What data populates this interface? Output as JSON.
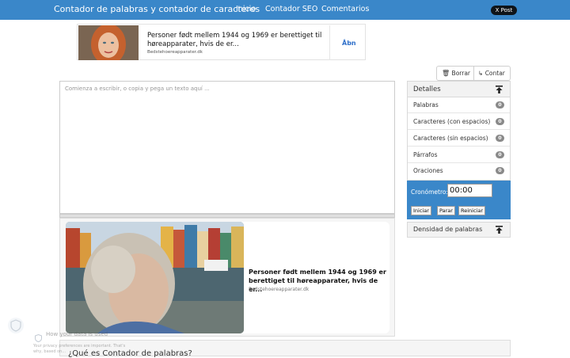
{
  "nav": {
    "brand": "Contador de palabras y contador de caracteres",
    "links": [
      "Inicio",
      "Contador SEO",
      "Comentarios"
    ],
    "share": "X Post"
  },
  "ad_top": {
    "title": "Personer født mellem 1944 og 1969 er berettiget til høreapparater, hvis de er...",
    "source": "Bedstehoereapparater.dk",
    "cta": "Åbn"
  },
  "toolbar": {
    "clear_label": "Borrar",
    "count_label": "Contar"
  },
  "editor": {
    "placeholder": "Comienza a escribir, o copia y pega un texto aquí ..."
  },
  "ad_big": {
    "title": "Personer født mellem 1944 og 1969 er berettiget til høreapparater, hvis de er...",
    "source": "Bedstehoereapparater.dk"
  },
  "details": {
    "title": "Detalles",
    "stats": [
      {
        "label": "Palabras",
        "value": "0"
      },
      {
        "label": "Caracteres (con espacios)",
        "value": "0"
      },
      {
        "label": "Caracteres (sin espacios)",
        "value": "0"
      },
      {
        "label": "Párrafos",
        "value": "0"
      },
      {
        "label": "Oraciones",
        "value": "0"
      }
    ]
  },
  "timer": {
    "label": "Cronómetro:",
    "value": "00:00",
    "start_label": "Iniciar",
    "stop_label": "Parar",
    "reset_label": "Reiniciar"
  },
  "density": {
    "title": "Densidad de palabras"
  },
  "section": {
    "title": "¿Qué es Contador de palabras?"
  },
  "privacy": {
    "title": "How your data is used",
    "line1": "Your privacy preferences are important. That's",
    "line2": "why, based on..."
  },
  "colors": {
    "nav_bg": "#3a87c9",
    "badge": "#8a8a8a",
    "link": "#2d6ec9"
  }
}
